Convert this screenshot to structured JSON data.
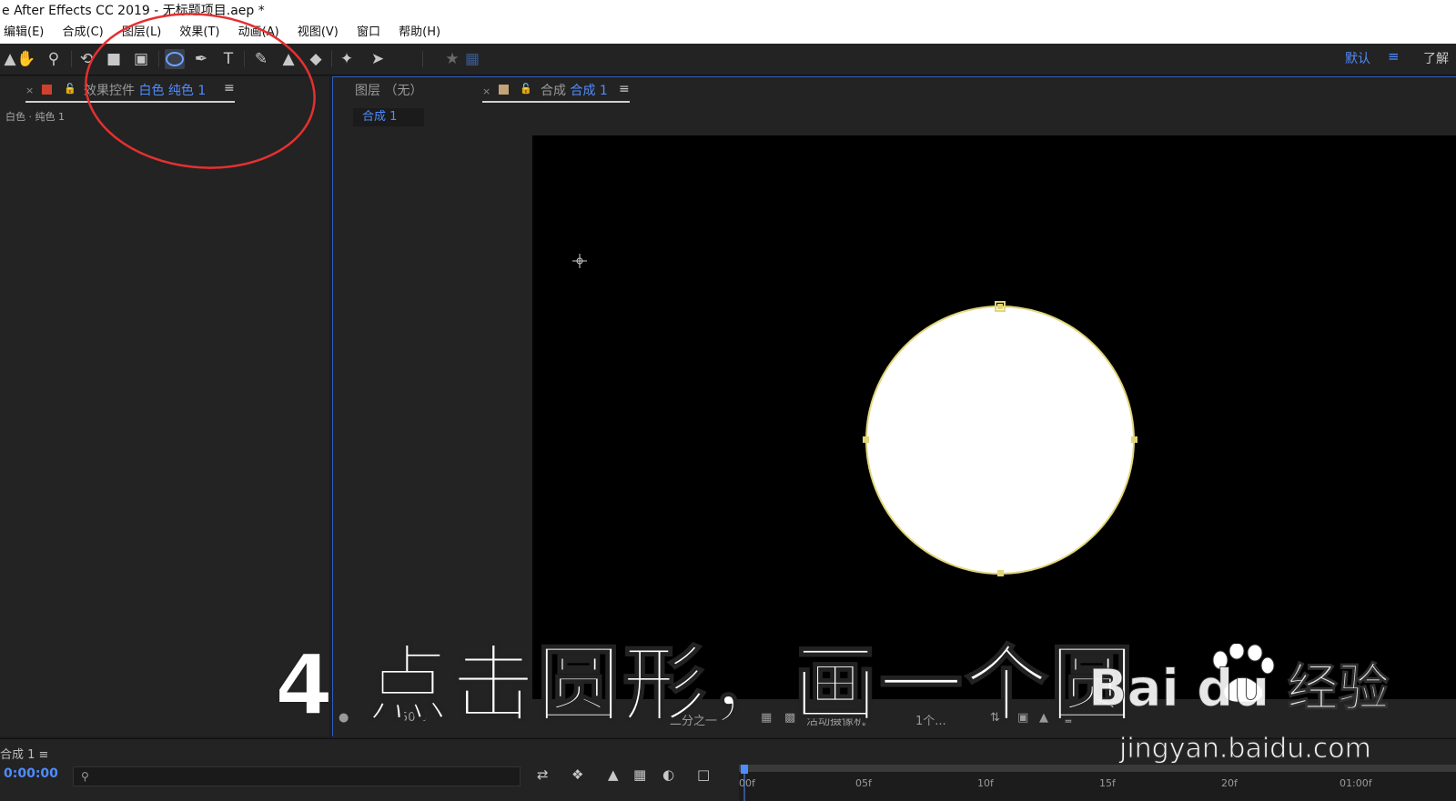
{
  "window": {
    "title": "e After Effects CC 2019 - 无标题项目.aep *"
  },
  "menu": {
    "items": [
      "编辑(E)",
      "合成(C)",
      "图层(L)",
      "效果(T)",
      "动画(A)",
      "视图(V)",
      "窗口",
      "帮助(H)"
    ]
  },
  "toolbar": {
    "icons": [
      "selection-arrow-icon",
      "hand-icon",
      "zoom-icon",
      "rotate-icon",
      "camera-icon",
      "pan-behind-icon",
      "ellipse-icon",
      "pen-icon",
      "text-icon",
      "brush-icon",
      "clone-stamp-icon",
      "eraser-icon",
      "roto-brush-icon",
      "puppet-pin-icon"
    ],
    "active_tool": "ellipse-icon",
    "workspace_default": "默认",
    "workspace_learn": "了解"
  },
  "effects_panel": {
    "tab_prefix": "效果控件",
    "tab_layer": "白色 纯色 1",
    "layer_line": "白色 · 纯色 1",
    "swatch_color": "#d0402e"
  },
  "comp_panel": {
    "layer_tab": "图层 （无）",
    "comp_tab_prefix": "合成",
    "comp_tab_name": "合成 1",
    "subtab": "合成 1",
    "swatch_color": "#c2a37a",
    "viewer_bottom": {
      "zoom": "50%",
      "resolution": "二分之一",
      "camera": "活动摄像机",
      "views": "1个..."
    }
  },
  "timeline": {
    "title": "合成 1",
    "timecode": "0:00:00",
    "ruler_labels": [
      "00f",
      "05f",
      "10f",
      "15f",
      "20f",
      "01:00f"
    ]
  },
  "overlay": {
    "caption": "4 点击圆形，画一个圆",
    "watermark_logo": "Bai du 经验",
    "watermark_url": "jingyan.baidu.com",
    "circle_color": "#ffffff",
    "outline_color": "#e1d57a",
    "annotation_color": "#e53030"
  }
}
